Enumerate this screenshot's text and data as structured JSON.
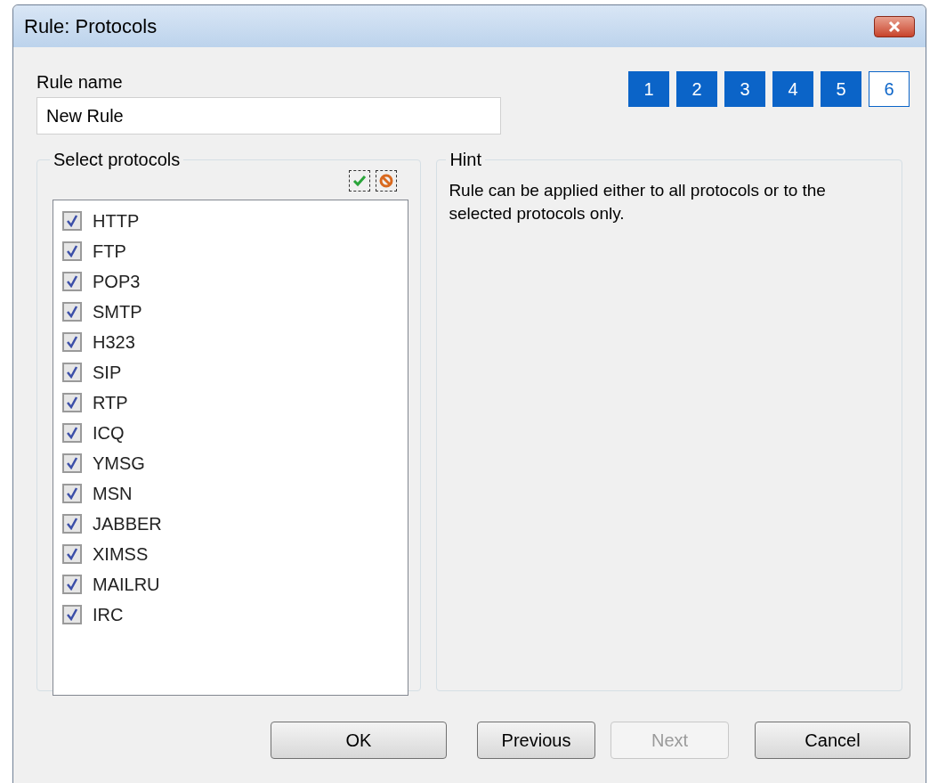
{
  "window": {
    "title": "Rule: Protocols"
  },
  "rule_name": {
    "label": "Rule name",
    "value": "New Rule"
  },
  "steps": [
    {
      "label": "1",
      "selected": false
    },
    {
      "label": "2",
      "selected": false
    },
    {
      "label": "3",
      "selected": false
    },
    {
      "label": "4",
      "selected": false
    },
    {
      "label": "5",
      "selected": false
    },
    {
      "label": "6",
      "selected": true
    }
  ],
  "protocols": {
    "title": "Select protocols",
    "items": [
      {
        "label": "HTTP",
        "checked": true
      },
      {
        "label": "FTP",
        "checked": true
      },
      {
        "label": "POP3",
        "checked": true
      },
      {
        "label": "SMTP",
        "checked": true
      },
      {
        "label": "H323",
        "checked": true
      },
      {
        "label": "SIP",
        "checked": true
      },
      {
        "label": "RTP",
        "checked": true
      },
      {
        "label": "ICQ",
        "checked": true
      },
      {
        "label": "YMSG",
        "checked": true
      },
      {
        "label": "MSN",
        "checked": true
      },
      {
        "label": "JABBER",
        "checked": true
      },
      {
        "label": "XIMSS",
        "checked": true
      },
      {
        "label": "MAILRU",
        "checked": true
      },
      {
        "label": "IRC",
        "checked": true
      }
    ]
  },
  "hint": {
    "title": "Hint",
    "text": "Rule can be applied either to all protocols or to the selected protocols only."
  },
  "buttons": [
    {
      "label": "OK",
      "disabled": false
    },
    {
      "label": "Previous",
      "disabled": false
    },
    {
      "label": "Next",
      "disabled": true
    },
    {
      "label": "Cancel",
      "disabled": false
    }
  ]
}
